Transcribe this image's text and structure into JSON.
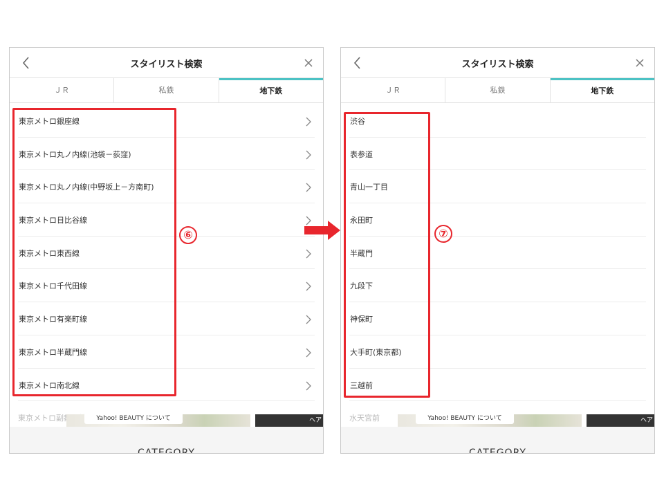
{
  "panels": [
    {
      "title": "スタイリスト検索",
      "tabs": [
        {
          "label": "ＪＲ",
          "active": false
        },
        {
          "label": "私鉄",
          "active": false
        },
        {
          "label": "地下鉄",
          "active": true
        }
      ],
      "items": [
        {
          "label": "東京メトロ銀座線"
        },
        {
          "label": "東京メトロ丸ノ内線(池袋－荻窪)"
        },
        {
          "label": "東京メトロ丸ノ内線(中野坂上－方南町)"
        },
        {
          "label": "東京メトロ日比谷線"
        },
        {
          "label": "東京メトロ東西線"
        },
        {
          "label": "東京メトロ千代田線"
        },
        {
          "label": "東京メトロ有楽町線"
        },
        {
          "label": "東京メトロ半蔵門線"
        },
        {
          "label": "東京メトロ南北線"
        }
      ],
      "partial_item": "東京メトロ副都心線",
      "banner": {
        "label": "Yahoo! BEAUTY について",
        "dark_text": "ヘア"
      },
      "footer": {
        "category": "CATEGORY"
      }
    },
    {
      "title": "スタイリスト検索",
      "tabs": [
        {
          "label": "ＪＲ",
          "active": false
        },
        {
          "label": "私鉄",
          "active": false
        },
        {
          "label": "地下鉄",
          "active": true
        }
      ],
      "items": [
        {
          "label": "渋谷"
        },
        {
          "label": "表参道"
        },
        {
          "label": "青山一丁目"
        },
        {
          "label": "永田町"
        },
        {
          "label": "半蔵門"
        },
        {
          "label": "九段下"
        },
        {
          "label": "神保町"
        },
        {
          "label": "大手町(東京都)"
        },
        {
          "label": "三越前"
        }
      ],
      "partial_item": "水天宮前",
      "banner": {
        "label": "Yahoo! BEAUTY について",
        "dark_text": "ヘア"
      },
      "footer": {
        "category": "CATEGORY"
      }
    }
  ],
  "annotations": {
    "step_left": "⑥",
    "step_right": "⑦"
  },
  "colors": {
    "highlight": "#e8262d",
    "tab_accent": "#4cc2c4"
  }
}
